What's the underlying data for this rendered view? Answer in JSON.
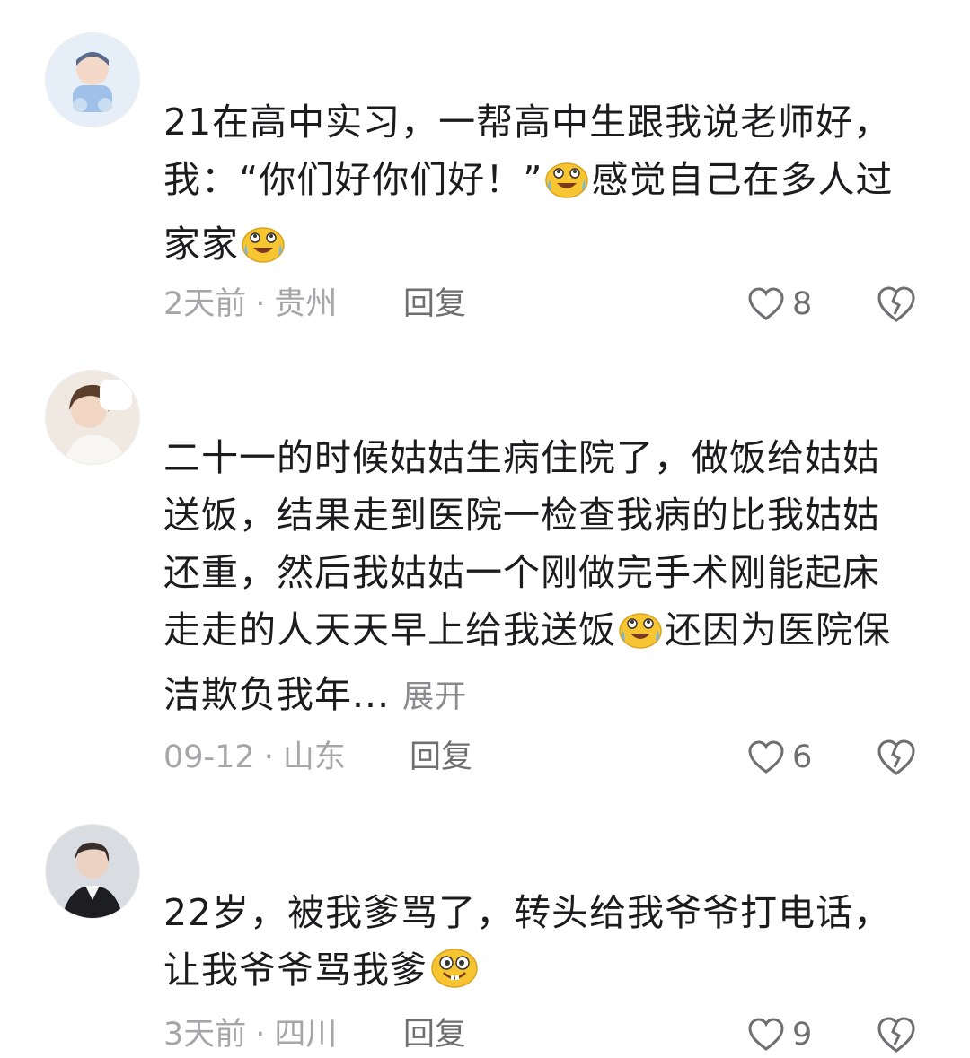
{
  "comments": [
    {
      "text_parts": [
        "21在高中实习，一帮高中生跟我说老师好，我：“你们好你们好！”",
        "感觉自己在多人过家家",
        ""
      ],
      "emojis": [
        "cry-laugh-emoji",
        "cry-laugh-emoji"
      ],
      "time": "2天前",
      "location": "贵州",
      "reply_label": "回复",
      "likes": "8"
    },
    {
      "text_parts": [
        "二十一的时候姑姑生病住院了，做饭给姑姑送饭，结果走到医院一检查我病的比我姑姑还重，然后我姑姑一个刚做完手术刚能起床走走的人天天早上给我送饭",
        "还因为医院保洁欺负我年..."
      ],
      "emojis": [
        "cry-laugh-emoji"
      ],
      "expand_label": "展开",
      "time": "09-12",
      "location": "山东",
      "reply_label": "回复",
      "likes": "6"
    },
    {
      "text_parts": [
        "22岁，被我爹骂了，转头给我爷爷打电话，让我爷爷骂我爹",
        ""
      ],
      "emojis": [
        "grin-emoji"
      ],
      "time": "3天前",
      "location": "四川",
      "reply_label": "回复",
      "likes": "9"
    }
  ],
  "separator": "·",
  "icons": {
    "like": "heart-outline-icon",
    "dislike": "broken-heart-icon"
  },
  "colors": {
    "text": "#1c1c1e",
    "meta": "#a5a5aa",
    "emoji": "#f7c531"
  }
}
